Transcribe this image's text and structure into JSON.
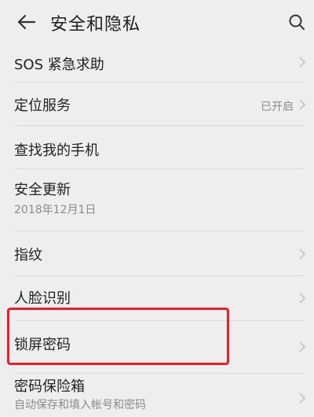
{
  "header": {
    "title": "安全和隐私",
    "back_icon": "arrow-left-icon",
    "search_icon": "search-icon"
  },
  "items": [
    {
      "title": "SOS 紧急求助"
    },
    {
      "title": "定位服务",
      "status": "已开启"
    },
    {
      "title": "查找我的手机"
    },
    {
      "title": "安全更新",
      "subtitle": "2018年12月1日"
    },
    {
      "title": "指纹"
    },
    {
      "title": "人脸识别"
    },
    {
      "title": "锁屏密码"
    },
    {
      "title": "密码保险箱",
      "subtitle": "自动保存和填入帐号和密码"
    }
  ],
  "colors": {
    "background": "#eeeeee",
    "highlight": "#e8202a"
  }
}
